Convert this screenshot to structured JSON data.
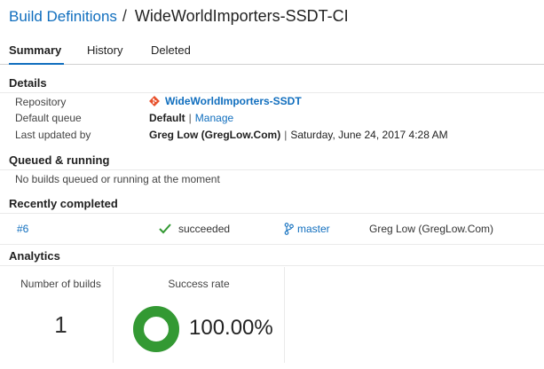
{
  "breadcrumb": {
    "parent": "Build Definitions",
    "separator": "/",
    "current": "WideWorldImporters-SSDT-CI"
  },
  "tabs": [
    {
      "label": "Summary",
      "active": true
    },
    {
      "label": "History",
      "active": false
    },
    {
      "label": "Deleted",
      "active": false
    }
  ],
  "details": {
    "title": "Details",
    "repository_label": "Repository",
    "repository_value": "WideWorldImporters-SSDT",
    "repository_icon": "git-icon",
    "queue_label": "Default queue",
    "queue_value": "Default",
    "queue_separator": "|",
    "queue_link": "Manage",
    "updated_label": "Last updated by",
    "updated_by": "Greg Low (GregLow.Com)",
    "updated_separator": "|",
    "updated_date": "Saturday, June 24, 2017 4:28 AM"
  },
  "queued": {
    "title": "Queued & running",
    "empty_message": "No builds queued or running at the moment"
  },
  "recent": {
    "title": "Recently completed",
    "builds": [
      {
        "number": "#6",
        "status": "succeeded",
        "status_icon": "check-icon",
        "branch": "master",
        "branch_icon": "branch-icon",
        "requested_by": "Greg Low (GregLow.Com)"
      }
    ]
  },
  "analytics": {
    "title": "Analytics",
    "builds_label": "Number of builds",
    "builds_count": "1",
    "success_label": "Success rate",
    "success_rate": "100.00%",
    "success_fraction": 1.0
  },
  "colors": {
    "accent": "#106ebe",
    "success": "#339933",
    "git": "#e8512c"
  }
}
